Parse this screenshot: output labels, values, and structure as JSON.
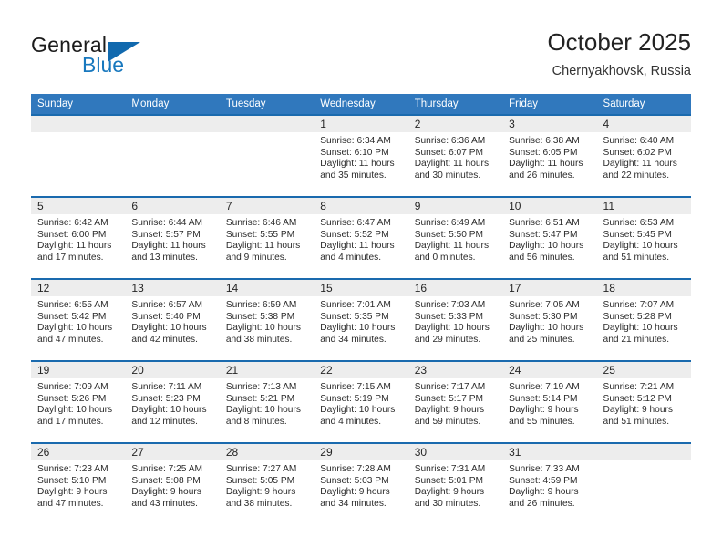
{
  "logo": {
    "word1": "General",
    "word2": "Blue",
    "triangle_color": "#1169ae",
    "blue_color": "#1878be"
  },
  "header": {
    "title": "October 2025",
    "subtitle": "Chernyakhovsk, Russia"
  },
  "theme": {
    "header_bg": "#3078bd",
    "row_divider": "#1a6aae",
    "daynum_band": "#ededed"
  },
  "weekday_headers": [
    "Sunday",
    "Monday",
    "Tuesday",
    "Wednesday",
    "Thursday",
    "Friday",
    "Saturday"
  ],
  "labels": {
    "sunrise_prefix": "Sunrise:",
    "sunset_prefix": "Sunset:",
    "daylight_prefix": "Daylight:"
  },
  "weeks": [
    [
      {
        "day": "",
        "lines": []
      },
      {
        "day": "",
        "lines": []
      },
      {
        "day": "",
        "lines": []
      },
      {
        "day": "1",
        "lines": [
          "Sunrise: 6:34 AM",
          "Sunset: 6:10 PM",
          "Daylight: 11 hours",
          "and 35 minutes."
        ]
      },
      {
        "day": "2",
        "lines": [
          "Sunrise: 6:36 AM",
          "Sunset: 6:07 PM",
          "Daylight: 11 hours",
          "and 30 minutes."
        ]
      },
      {
        "day": "3",
        "lines": [
          "Sunrise: 6:38 AM",
          "Sunset: 6:05 PM",
          "Daylight: 11 hours",
          "and 26 minutes."
        ]
      },
      {
        "day": "4",
        "lines": [
          "Sunrise: 6:40 AM",
          "Sunset: 6:02 PM",
          "Daylight: 11 hours",
          "and 22 minutes."
        ]
      }
    ],
    [
      {
        "day": "5",
        "lines": [
          "Sunrise: 6:42 AM",
          "Sunset: 6:00 PM",
          "Daylight: 11 hours",
          "and 17 minutes."
        ]
      },
      {
        "day": "6",
        "lines": [
          "Sunrise: 6:44 AM",
          "Sunset: 5:57 PM",
          "Daylight: 11 hours",
          "and 13 minutes."
        ]
      },
      {
        "day": "7",
        "lines": [
          "Sunrise: 6:46 AM",
          "Sunset: 5:55 PM",
          "Daylight: 11 hours",
          "and 9 minutes."
        ]
      },
      {
        "day": "8",
        "lines": [
          "Sunrise: 6:47 AM",
          "Sunset: 5:52 PM",
          "Daylight: 11 hours",
          "and 4 minutes."
        ]
      },
      {
        "day": "9",
        "lines": [
          "Sunrise: 6:49 AM",
          "Sunset: 5:50 PM",
          "Daylight: 11 hours",
          "and 0 minutes."
        ]
      },
      {
        "day": "10",
        "lines": [
          "Sunrise: 6:51 AM",
          "Sunset: 5:47 PM",
          "Daylight: 10 hours",
          "and 56 minutes."
        ]
      },
      {
        "day": "11",
        "lines": [
          "Sunrise: 6:53 AM",
          "Sunset: 5:45 PM",
          "Daylight: 10 hours",
          "and 51 minutes."
        ]
      }
    ],
    [
      {
        "day": "12",
        "lines": [
          "Sunrise: 6:55 AM",
          "Sunset: 5:42 PM",
          "Daylight: 10 hours",
          "and 47 minutes."
        ]
      },
      {
        "day": "13",
        "lines": [
          "Sunrise: 6:57 AM",
          "Sunset: 5:40 PM",
          "Daylight: 10 hours",
          "and 42 minutes."
        ]
      },
      {
        "day": "14",
        "lines": [
          "Sunrise: 6:59 AM",
          "Sunset: 5:38 PM",
          "Daylight: 10 hours",
          "and 38 minutes."
        ]
      },
      {
        "day": "15",
        "lines": [
          "Sunrise: 7:01 AM",
          "Sunset: 5:35 PM",
          "Daylight: 10 hours",
          "and 34 minutes."
        ]
      },
      {
        "day": "16",
        "lines": [
          "Sunrise: 7:03 AM",
          "Sunset: 5:33 PM",
          "Daylight: 10 hours",
          "and 29 minutes."
        ]
      },
      {
        "day": "17",
        "lines": [
          "Sunrise: 7:05 AM",
          "Sunset: 5:30 PM",
          "Daylight: 10 hours",
          "and 25 minutes."
        ]
      },
      {
        "day": "18",
        "lines": [
          "Sunrise: 7:07 AM",
          "Sunset: 5:28 PM",
          "Daylight: 10 hours",
          "and 21 minutes."
        ]
      }
    ],
    [
      {
        "day": "19",
        "lines": [
          "Sunrise: 7:09 AM",
          "Sunset: 5:26 PM",
          "Daylight: 10 hours",
          "and 17 minutes."
        ]
      },
      {
        "day": "20",
        "lines": [
          "Sunrise: 7:11 AM",
          "Sunset: 5:23 PM",
          "Daylight: 10 hours",
          "and 12 minutes."
        ]
      },
      {
        "day": "21",
        "lines": [
          "Sunrise: 7:13 AM",
          "Sunset: 5:21 PM",
          "Daylight: 10 hours",
          "and 8 minutes."
        ]
      },
      {
        "day": "22",
        "lines": [
          "Sunrise: 7:15 AM",
          "Sunset: 5:19 PM",
          "Daylight: 10 hours",
          "and 4 minutes."
        ]
      },
      {
        "day": "23",
        "lines": [
          "Sunrise: 7:17 AM",
          "Sunset: 5:17 PM",
          "Daylight: 9 hours",
          "and 59 minutes."
        ]
      },
      {
        "day": "24",
        "lines": [
          "Sunrise: 7:19 AM",
          "Sunset: 5:14 PM",
          "Daylight: 9 hours",
          "and 55 minutes."
        ]
      },
      {
        "day": "25",
        "lines": [
          "Sunrise: 7:21 AM",
          "Sunset: 5:12 PM",
          "Daylight: 9 hours",
          "and 51 minutes."
        ]
      }
    ],
    [
      {
        "day": "26",
        "lines": [
          "Sunrise: 7:23 AM",
          "Sunset: 5:10 PM",
          "Daylight: 9 hours",
          "and 47 minutes."
        ]
      },
      {
        "day": "27",
        "lines": [
          "Sunrise: 7:25 AM",
          "Sunset: 5:08 PM",
          "Daylight: 9 hours",
          "and 43 minutes."
        ]
      },
      {
        "day": "28",
        "lines": [
          "Sunrise: 7:27 AM",
          "Sunset: 5:05 PM",
          "Daylight: 9 hours",
          "and 38 minutes."
        ]
      },
      {
        "day": "29",
        "lines": [
          "Sunrise: 7:28 AM",
          "Sunset: 5:03 PM",
          "Daylight: 9 hours",
          "and 34 minutes."
        ]
      },
      {
        "day": "30",
        "lines": [
          "Sunrise: 7:31 AM",
          "Sunset: 5:01 PM",
          "Daylight: 9 hours",
          "and 30 minutes."
        ]
      },
      {
        "day": "31",
        "lines": [
          "Sunrise: 7:33 AM",
          "Sunset: 4:59 PM",
          "Daylight: 9 hours",
          "and 26 minutes."
        ]
      },
      {
        "day": "",
        "lines": []
      }
    ]
  ]
}
